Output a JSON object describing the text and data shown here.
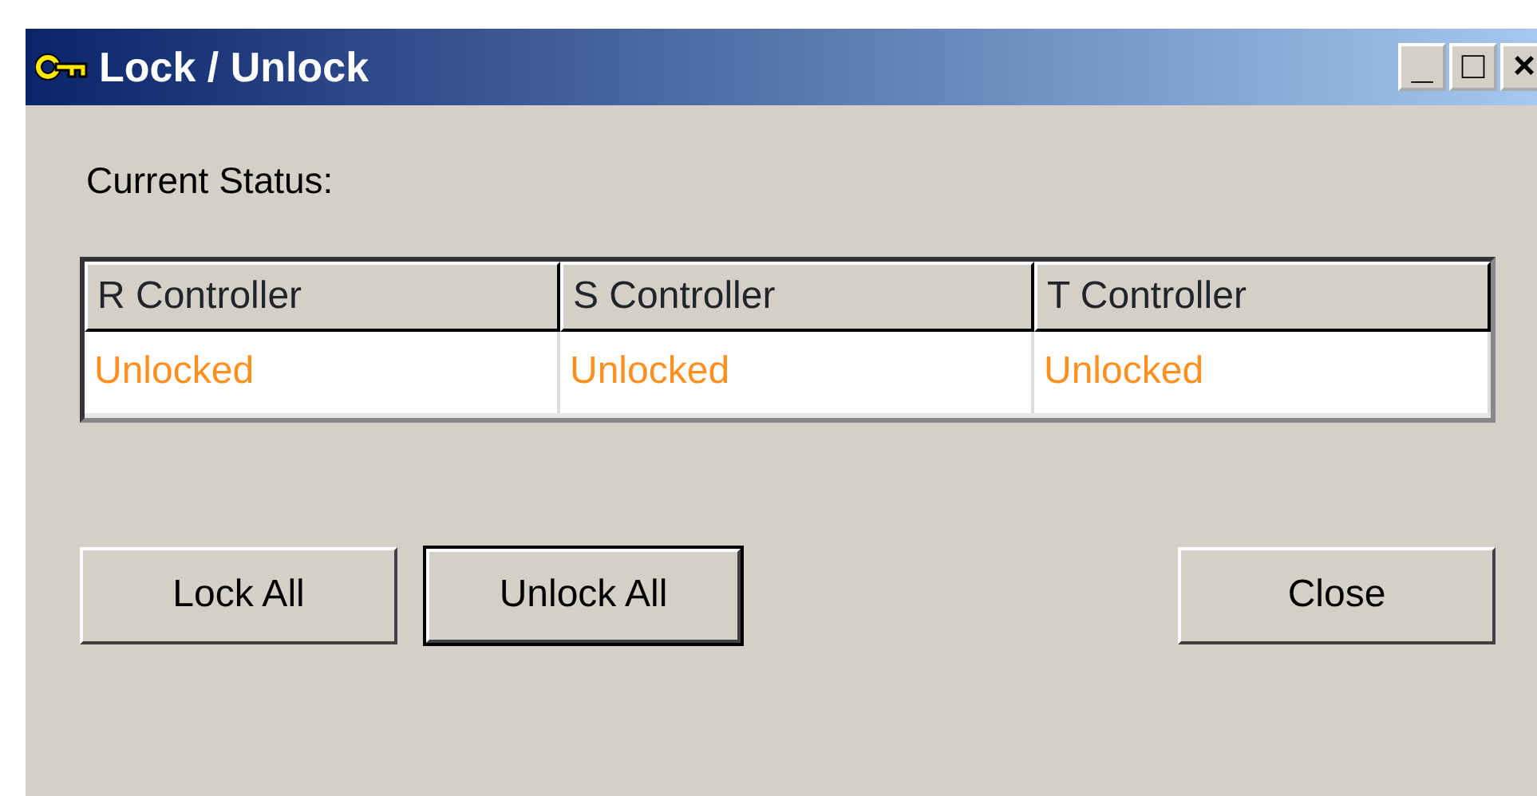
{
  "window": {
    "title": "Lock / Unlock",
    "controls": [
      "_",
      "□",
      "×"
    ]
  },
  "status_label": "Current Status:",
  "table": {
    "columns": [
      "R Controller",
      "S Controller",
      "T Controller"
    ],
    "rows": [
      [
        {
          "text": "Unlocked",
          "locked": false
        },
        {
          "text": "Unlocked",
          "locked": false
        },
        {
          "text": "Unlocked",
          "locked": false
        }
      ]
    ]
  },
  "buttons": [
    {
      "label": "Lock All",
      "default": false
    },
    {
      "label": "Unlock All",
      "default": true
    },
    {
      "label": "Close",
      "default": false
    }
  ]
}
